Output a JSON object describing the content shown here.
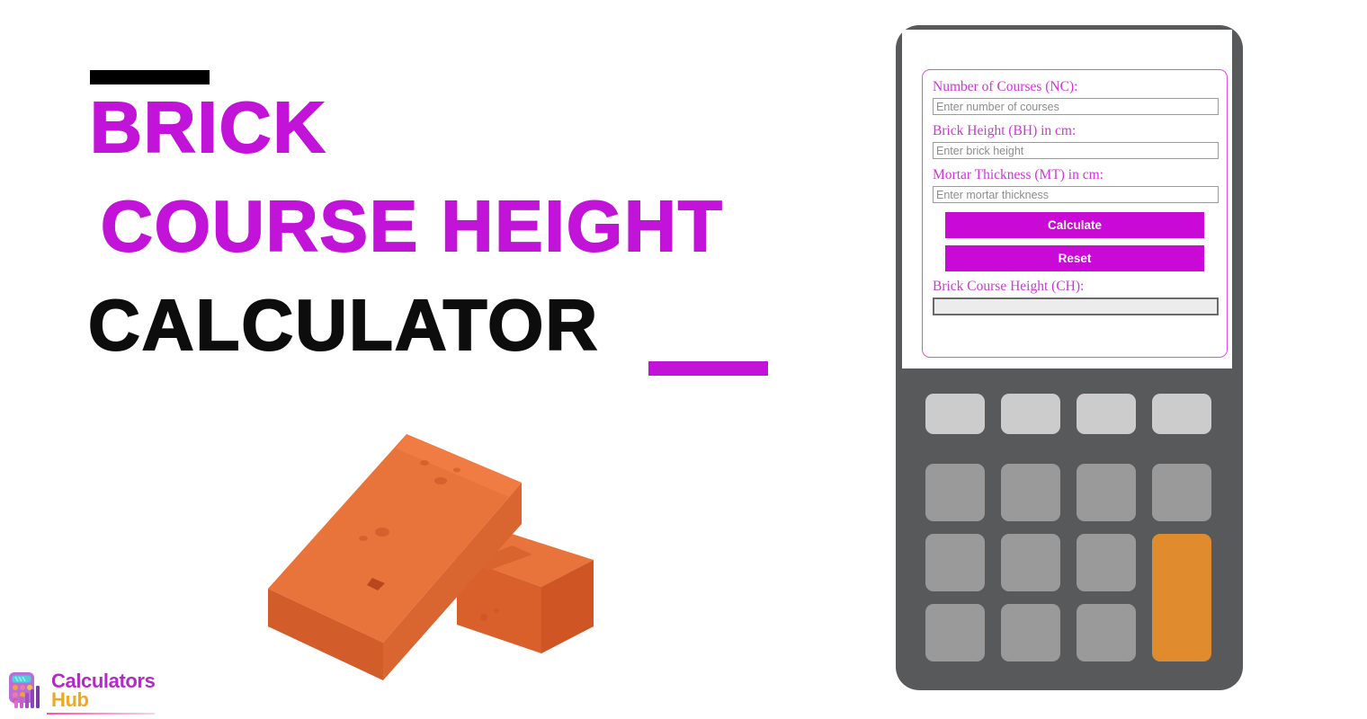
{
  "page": {
    "title_lines": [
      "BRICK",
      "COURSE HEIGHT",
      "CALCULATOR"
    ],
    "colors": {
      "magenta": "#c213d8",
      "black": "#000000",
      "calculator_body": "#58595b",
      "key_light": "#cccccc",
      "key_mid": "#9a9a9a",
      "key_accent": "#e08b2e",
      "brick_orange": "#e2692f",
      "label_magenta": "#cf35d8",
      "button_magenta": "#c90ad6"
    }
  },
  "accents": {
    "top_bar_name": "black-accent-bar",
    "bottom_bar_name": "magenta-accent-bar"
  },
  "illustration": {
    "name": "brick-illustration",
    "alt": "Two orange 3D bricks"
  },
  "logo": {
    "word_1": "Calculators",
    "word_2": "Hub",
    "icon_name": "calculator-bars-logo-icon"
  },
  "calculator": {
    "form": {
      "fields": [
        {
          "label": "Number of Courses (NC):",
          "placeholder": "Enter number of courses",
          "value": "",
          "name": "number-of-courses-input"
        },
        {
          "label": "Brick Height (BH) in cm:",
          "placeholder": "Enter brick height",
          "value": "",
          "name": "brick-height-input"
        },
        {
          "label": "Mortar Thickness (MT) in cm:",
          "placeholder": "Enter mortar thickness",
          "value": "",
          "name": "mortar-thickness-input"
        }
      ],
      "buttons": {
        "calculate": "Calculate",
        "reset": "Reset"
      },
      "result": {
        "label": "Brick Course Height (CH):",
        "value": ""
      }
    },
    "keypad": {
      "rows": 4,
      "columns": 4,
      "accent_key_name": "equals-key"
    }
  }
}
